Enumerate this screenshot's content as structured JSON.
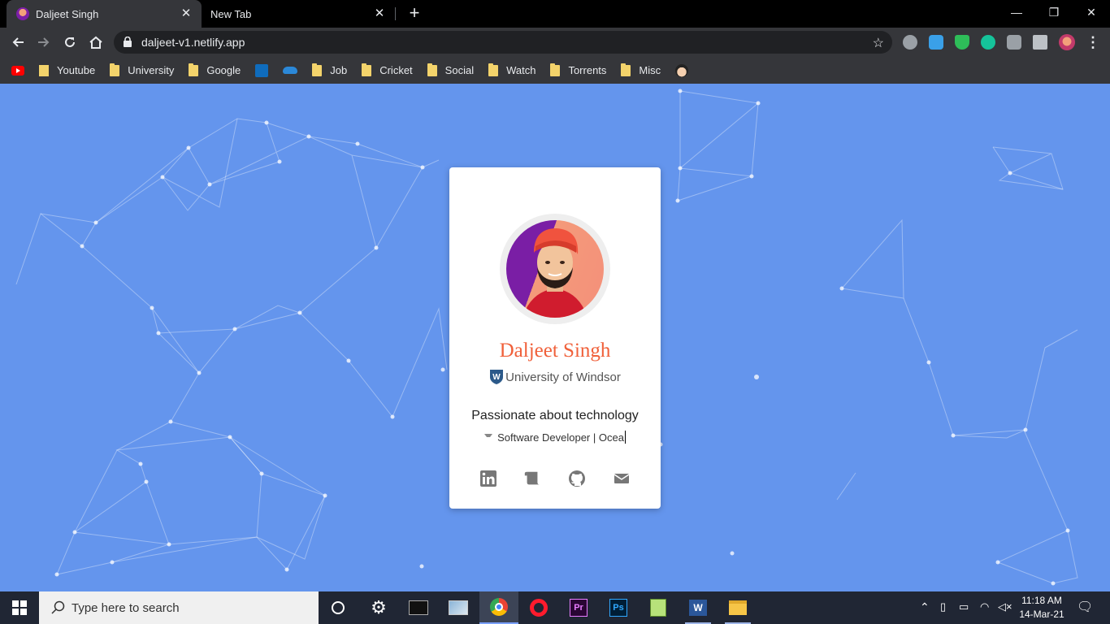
{
  "browser": {
    "tabs": [
      {
        "title": "Daljeet Singh",
        "active": true
      },
      {
        "title": "New Tab",
        "active": false
      }
    ],
    "url": "daljeet-v1.netlify.app",
    "bookmarks": [
      "Youtube",
      "University",
      "Google",
      "Job",
      "Cricket",
      "Social",
      "Watch",
      "Torrents",
      "Misc"
    ],
    "window_controls": {
      "minimize": "—",
      "restore": "❐",
      "close": "✕"
    }
  },
  "profile": {
    "name": "Daljeet Singh",
    "university": "University of Windsor",
    "tagline": "Passionate about technology",
    "role_typed": "Software Developer | Ocea",
    "social_icons": [
      "linkedin-icon",
      "blog-scroll-icon",
      "github-icon",
      "email-icon"
    ]
  },
  "taskbar": {
    "search_placeholder": "Type here to search",
    "time": "11:18 AM",
    "date": "14-Mar-21"
  },
  "colors": {
    "page_background": "#6495ed",
    "name_accent": "#f0603a",
    "card_background": "#ffffff"
  }
}
